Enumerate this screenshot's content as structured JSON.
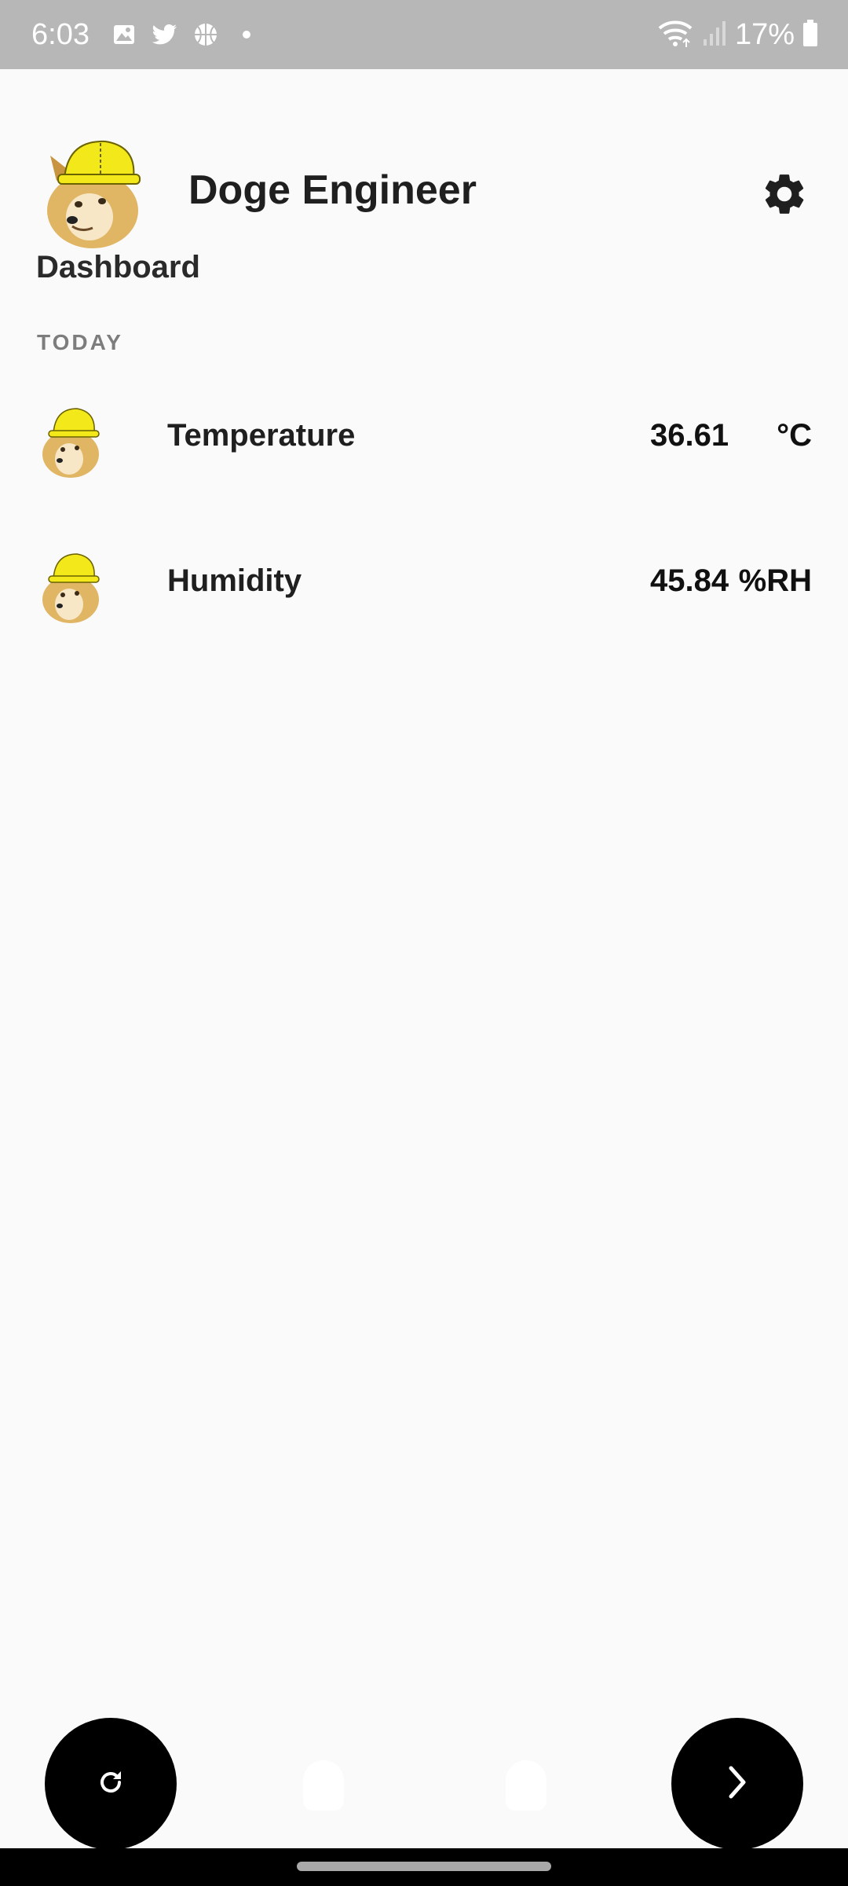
{
  "status_bar": {
    "time": "6:03",
    "battery": "17%",
    "left_icons": [
      "gallery-icon",
      "twitter-icon",
      "basketball-icon",
      "dot-icon"
    ],
    "right_icons": [
      "wifi-icon",
      "signal-icon",
      "battery-icon"
    ]
  },
  "header": {
    "title": "Doge Engineer",
    "subtitle": "Dashboard",
    "logo_icon": "doge-hardhat-icon",
    "settings_icon": "gear-icon"
  },
  "section": {
    "label": "TODAY"
  },
  "sensors": [
    {
      "label": "Temperature",
      "value": "36.61",
      "unit": "°C",
      "icon": "doge-hardhat-icon"
    },
    {
      "label": "Humidity",
      "value": "45.84",
      "unit": "%RH",
      "icon": "doge-hardhat-icon"
    }
  ],
  "bottom_actions": {
    "refresh_icon": "refresh-icon",
    "next_icon": "chevron-right-icon"
  },
  "colors": {
    "status_bar": "#b7b7b7",
    "background": "#fafafa",
    "fab": "#000000",
    "nav_bar": "#000000",
    "hardhat": "#f3e81a",
    "doge_fur": "#e0b665"
  }
}
